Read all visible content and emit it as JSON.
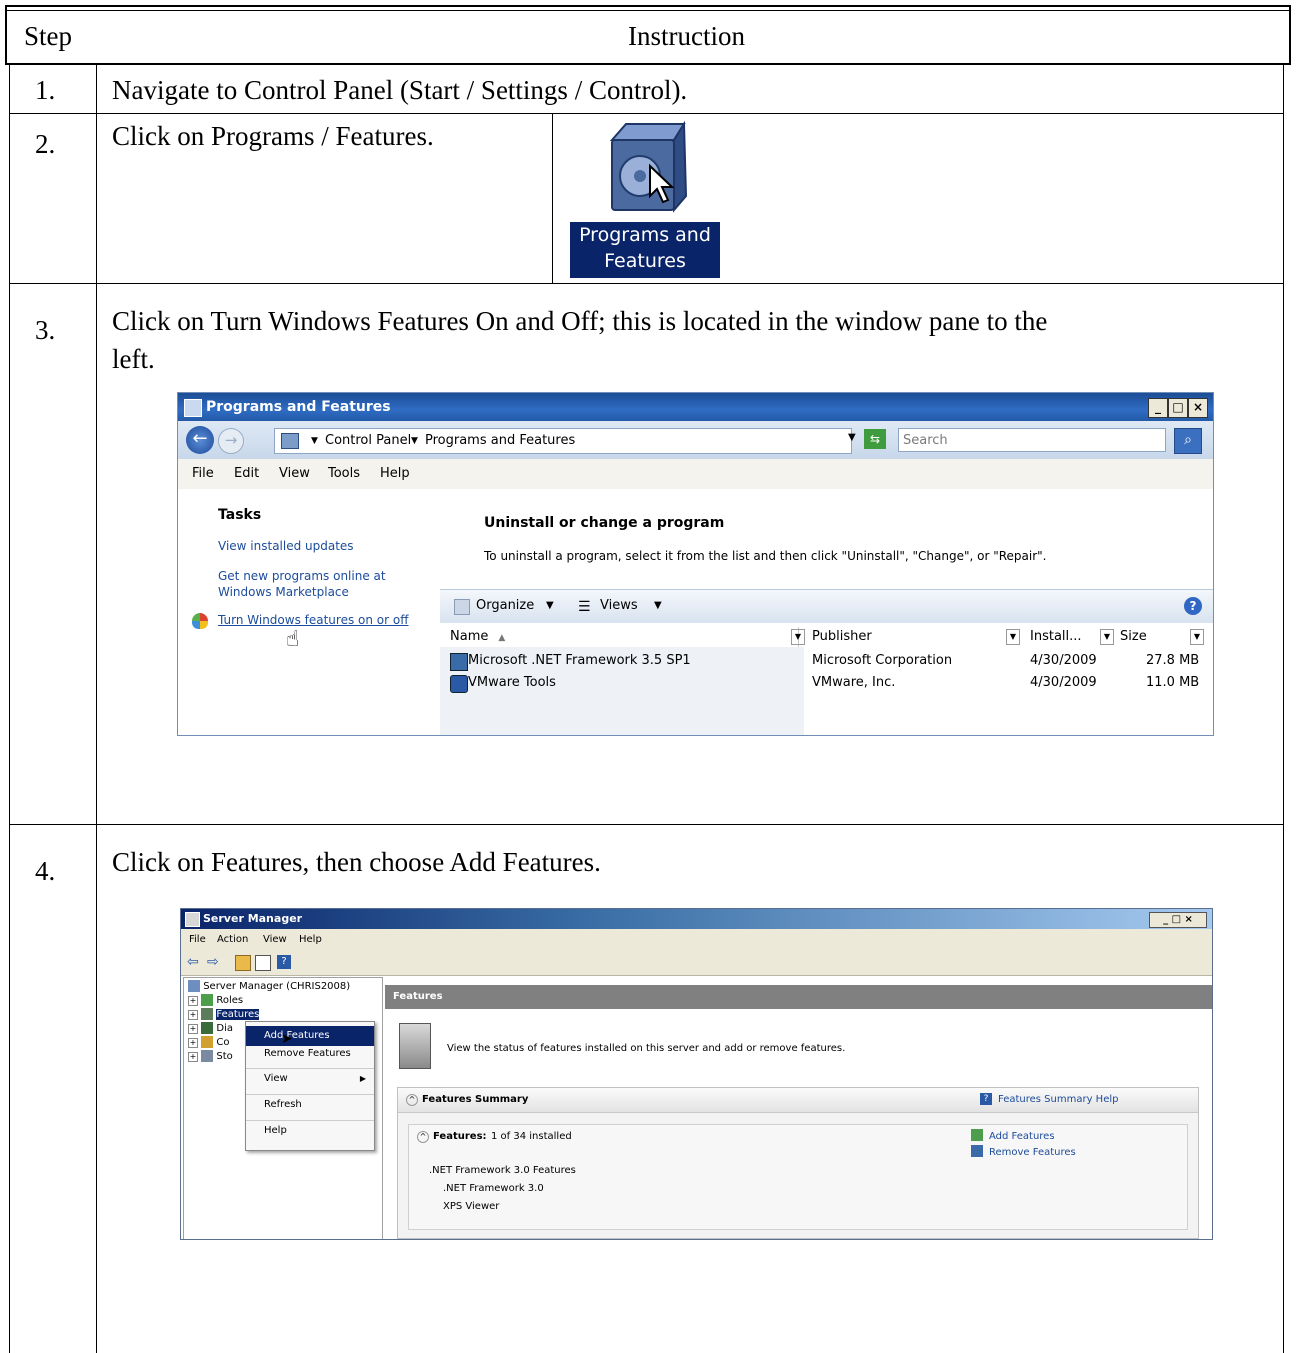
{
  "table": {
    "header": {
      "step": "Step",
      "instruction": "Instruction"
    },
    "rows": [
      {
        "step": "1.",
        "instruction": "Navigate to Control Panel (Start / Settings / Control)."
      },
      {
        "step": "2.",
        "instruction": "Click on Programs / Features."
      },
      {
        "step": "3.",
        "instruction_line1": "Click on Turn Windows Features On and Off; this is located in the window pane to the",
        "instruction_line2": "left."
      },
      {
        "step": "4.",
        "instruction": "Click on Features, then choose Add Features."
      }
    ]
  },
  "programs_icon": {
    "label_line1": "Programs and",
    "label_line2": "Features"
  },
  "programs_window": {
    "title": "Programs and Features",
    "title_buttons": [
      "_",
      "□",
      "×"
    ],
    "breadcrumb": [
      "Control Panel",
      "Programs and Features"
    ],
    "search_placeholder": "Search",
    "menu": [
      "File",
      "Edit",
      "View",
      "Tools",
      "Help"
    ],
    "tasks_heading": "Tasks",
    "tasks": [
      "View installed updates",
      "Get new programs online at",
      "Windows Marketplace",
      "Turn Windows features on or off"
    ],
    "main_heading": "Uninstall or change a program",
    "main_subtitle": "To uninstall a program, select it from the list and then click \"Uninstall\", \"Change\", or \"Repair\".",
    "toolbar": {
      "organize": "Organize",
      "views": "Views"
    },
    "columns": [
      "Name",
      "Publisher",
      "Install...",
      "Size"
    ],
    "programs": [
      {
        "name": "Microsoft .NET Framework 3.5 SP1",
        "publisher": "Microsoft Corporation",
        "installed": "4/30/2009",
        "size": "27.8 MB"
      },
      {
        "name": "VMware Tools",
        "publisher": "VMware, Inc.",
        "installed": "4/30/2009",
        "size": "11.0 MB"
      }
    ]
  },
  "server_manager": {
    "title": "Server Manager",
    "menu": [
      "File",
      "Action",
      "View",
      "Help"
    ],
    "tree": [
      "Server Manager (CHRIS2008)",
      "Roles",
      "Features",
      "Dia",
      "Co",
      "Sto"
    ],
    "context_menu": [
      "Add Features",
      "Remove Features",
      "View",
      "Refresh",
      "Help"
    ],
    "header": "Features",
    "description": "View the status of features installed on this server and add or remove features.",
    "summary_title": "Features Summary",
    "summary_help": "Features Summary Help",
    "features_label": "Features:",
    "features_count": "1 of 34 installed",
    "installed_features": [
      ".NET Framework 3.0 Features",
      ".NET Framework 3.0",
      "XPS Viewer"
    ],
    "actions": [
      "Add Features",
      "Remove Features"
    ]
  }
}
